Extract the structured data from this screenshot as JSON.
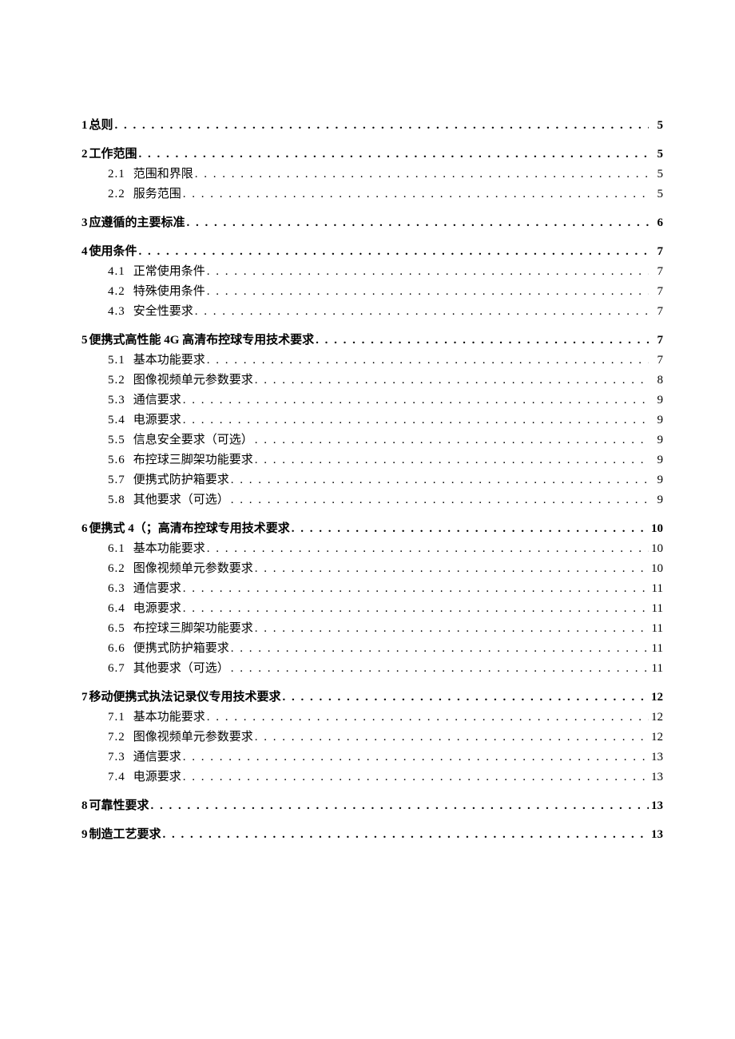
{
  "toc": [
    {
      "level": 1,
      "num": "1",
      "title": "总则",
      "page": "5"
    },
    {
      "level": 1,
      "num": "2",
      "title": "工作范围",
      "page": "5"
    },
    {
      "level": 2,
      "num": "2.1",
      "title": "范围和界限",
      "page": "5"
    },
    {
      "level": 2,
      "num": "2.2",
      "title": "服务范围",
      "page": "5"
    },
    {
      "level": 1,
      "num": "3",
      "title": "应遵循的主要标准",
      "page": "6"
    },
    {
      "level": 1,
      "num": "4",
      "title": "使用条件",
      "page": "7"
    },
    {
      "level": 2,
      "num": "4.1",
      "title": "正常使用条件",
      "page": "7"
    },
    {
      "level": 2,
      "num": "4.2",
      "title": "特殊使用条件",
      "page": "7"
    },
    {
      "level": 2,
      "num": "4.3",
      "title": "安全性要求",
      "page": "7"
    },
    {
      "level": 1,
      "num": "5",
      "title": "便携式高性能 4G 高清布控球专用技术要求",
      "page": "7"
    },
    {
      "level": 2,
      "num": "5.1",
      "title": "基本功能要求",
      "page": "7"
    },
    {
      "level": 2,
      "num": "5.2",
      "title": "图像视频单元参数要求",
      "page": "8"
    },
    {
      "level": 2,
      "num": "5.3",
      "title": "通信要求",
      "page": "9"
    },
    {
      "level": 2,
      "num": "5.4",
      "title": "电源要求",
      "page": "9"
    },
    {
      "level": 2,
      "num": "5.5",
      "title": "信息安全要求（可选）",
      "page": "9"
    },
    {
      "level": 2,
      "num": "5.6",
      "title": "布控球三脚架功能要求",
      "page": "9"
    },
    {
      "level": 2,
      "num": "5.7",
      "title": "便携式防护箱要求",
      "page": "9"
    },
    {
      "level": 2,
      "num": "5.8",
      "title": "其他要求（可选）",
      "page": "9"
    },
    {
      "level": 1,
      "num": "6",
      "title": "便携式 4（；高清布控球专用技术要求",
      "page": "10"
    },
    {
      "level": 2,
      "num": "6.1",
      "title": "基本功能要求",
      "page": "10"
    },
    {
      "level": 2,
      "num": "6.2",
      "title": "图像视频单元参数要求",
      "page": "10"
    },
    {
      "level": 2,
      "num": "6.3",
      "title": "通信要求",
      "page": "11"
    },
    {
      "level": 2,
      "num": "6.4",
      "title": "电源要求",
      "page": "11"
    },
    {
      "level": 2,
      "num": "6.5",
      "title": "布控球三脚架功能要求",
      "page": "11"
    },
    {
      "level": 2,
      "num": "6.6",
      "title": "便携式防护箱要求",
      "page": "11"
    },
    {
      "level": 2,
      "num": "6.7",
      "title": "其他要求（可选）",
      "page": "11"
    },
    {
      "level": 1,
      "num": "7",
      "title": "移动便携式执法记录仪专用技术要求",
      "page": "12"
    },
    {
      "level": 2,
      "num": "7.1",
      "title": "基本功能要求",
      "page": "12"
    },
    {
      "level": 2,
      "num": "7.2",
      "title": "图像视频单元参数要求",
      "page": "12"
    },
    {
      "level": 2,
      "num": "7.3",
      "title": "通信要求",
      "page": "13"
    },
    {
      "level": 2,
      "num": "7.4",
      "title": "电源要求",
      "page": "13"
    },
    {
      "level": 1,
      "num": "8",
      "title": "可靠性要求",
      "page": "13"
    },
    {
      "level": 1,
      "num": "9",
      "title": "制造工艺要求",
      "page": "13"
    }
  ]
}
